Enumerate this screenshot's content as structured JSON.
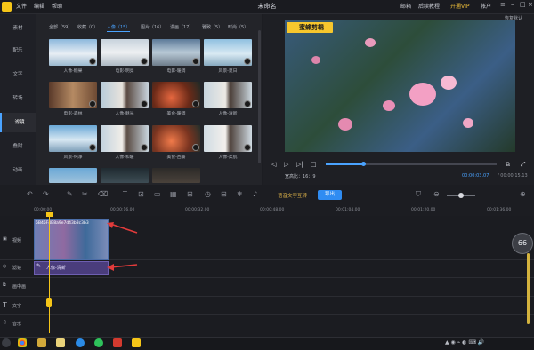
{
  "titlebar": {
    "menus": [
      "文件",
      "编辑",
      "帮助"
    ],
    "title": "未命名",
    "right_buttons": [
      "邮箱",
      "后续教程",
      "开通VIP",
      "帐户"
    ]
  },
  "leftnav": {
    "items": [
      "素材",
      "配乐",
      "文字",
      "转场",
      "滤镜",
      "叠附",
      "动画"
    ]
  },
  "filters": {
    "tabs": [
      "全部（59）",
      "收藏（0）",
      "人像（15）",
      "图片（16）",
      "漫画（17）",
      "雅致（5）",
      "时尚（5）"
    ],
    "active_tab_index": 2,
    "thumbs": [
      {
        "label": "人像-糖果"
      },
      {
        "label": "电影-明亮"
      },
      {
        "label": "电影-暖调"
      },
      {
        "label": "风景-夏日"
      },
      {
        "label": "电影-森林"
      },
      {
        "label": "人像-魅光"
      },
      {
        "label": "美食-暖调"
      },
      {
        "label": "人像-清新"
      },
      {
        "label": "风景-纯净"
      },
      {
        "label": "人像-和暖"
      },
      {
        "label": "美食-西餐"
      },
      {
        "label": "人像-柔肌"
      },
      {
        "label": ""
      },
      {
        "label": ""
      },
      {
        "label": ""
      }
    ]
  },
  "preview": {
    "restore_label": "恢复默认",
    "watermark": "蜜蜂剪辑",
    "progress": 0.22,
    "ratio": "宽高比：16：9",
    "time_current": "00:00:03.07",
    "time_total": "/ 00:00:15.13"
  },
  "toolbar": {
    "voice_text": "语音文字互转",
    "export_label": "导出"
  },
  "timeline": {
    "ticks": [
      "00:00:00",
      "00:00:16.00",
      "00:00:32.00",
      "00:00:48.00",
      "00:01:04.00",
      "00:01:20.00",
      "00:01:36.00"
    ],
    "tracks": [
      "视频",
      "滤镜",
      "画中画",
      "文字",
      "音乐"
    ],
    "clip_name": "5B45F4B8a9e7d43b8c3b3",
    "filter_clip_label": "人像-清新",
    "zoom_badge": "66"
  }
}
